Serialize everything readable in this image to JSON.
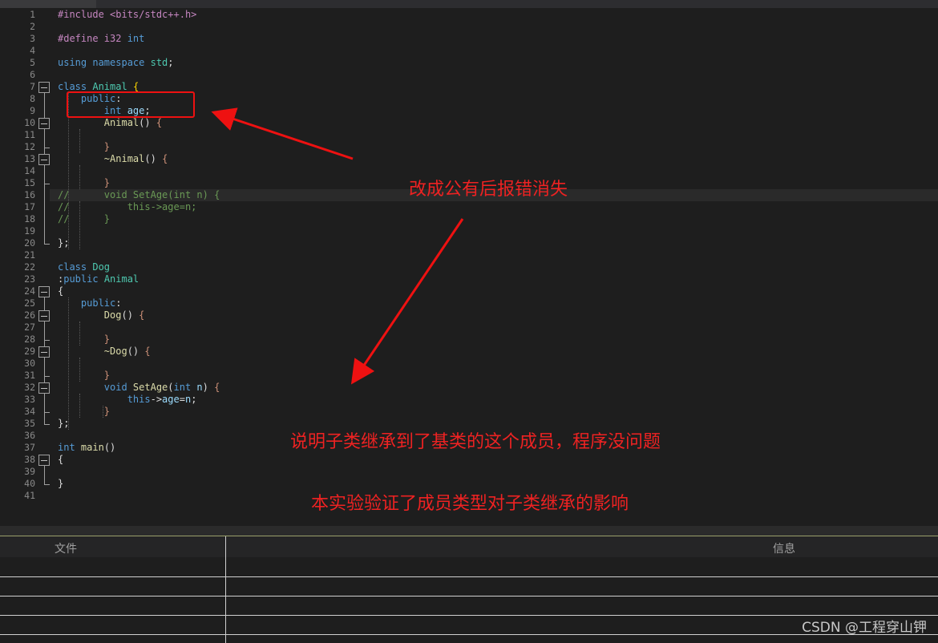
{
  "tab": {
    "label": ""
  },
  "code_lines": [
    {
      "n": "1",
      "tokens": [
        {
          "t": "#include <bits/stdc++.h>",
          "c": "pre"
        }
      ]
    },
    {
      "n": "2",
      "tokens": []
    },
    {
      "n": "3",
      "tokens": [
        {
          "t": "#define ",
          "c": "pre"
        },
        {
          "t": "i32 ",
          "c": "pre"
        },
        {
          "t": "int",
          "c": "kw"
        }
      ]
    },
    {
      "n": "4",
      "tokens": []
    },
    {
      "n": "5",
      "tokens": [
        {
          "t": "using ",
          "c": "kw"
        },
        {
          "t": "namespace ",
          "c": "kw"
        },
        {
          "t": "std",
          "c": "type"
        },
        {
          "t": ";",
          "c": ""
        }
      ]
    },
    {
      "n": "6",
      "tokens": []
    },
    {
      "n": "7",
      "tokens": [
        {
          "t": "class ",
          "c": "kw"
        },
        {
          "t": "Animal ",
          "c": "type"
        },
        {
          "t": "{",
          "c": "br"
        }
      ]
    },
    {
      "n": "8",
      "tokens": [
        {
          "t": "    public",
          "c": "kw"
        },
        {
          "t": ":",
          "c": ""
        }
      ]
    },
    {
      "n": "9",
      "tokens": [
        {
          "t": "        int ",
          "c": "kw"
        },
        {
          "t": "age",
          "c": "var"
        },
        {
          "t": ";",
          "c": ""
        }
      ]
    },
    {
      "n": "10",
      "tokens": [
        {
          "t": "        Animal",
          "c": "fn"
        },
        {
          "t": "() ",
          "c": ""
        },
        {
          "t": "{",
          "c": "str"
        }
      ]
    },
    {
      "n": "11",
      "tokens": []
    },
    {
      "n": "12",
      "tokens": [
        {
          "t": "        }",
          "c": "str"
        }
      ]
    },
    {
      "n": "13",
      "tokens": [
        {
          "t": "        ~Animal",
          "c": "fn"
        },
        {
          "t": "() ",
          "c": ""
        },
        {
          "t": "{",
          "c": "str"
        }
      ]
    },
    {
      "n": "14",
      "tokens": []
    },
    {
      "n": "15",
      "tokens": [
        {
          "t": "        }",
          "c": "str"
        }
      ]
    },
    {
      "n": "16",
      "tokens": [
        {
          "t": "//      void SetAge(int n) {",
          "c": "cm"
        }
      ]
    },
    {
      "n": "17",
      "tokens": [
        {
          "t": "//          this->age=n;",
          "c": "cm"
        }
      ]
    },
    {
      "n": "18",
      "tokens": [
        {
          "t": "//      }",
          "c": "cm"
        }
      ]
    },
    {
      "n": "19",
      "tokens": []
    },
    {
      "n": "20",
      "tokens": [
        {
          "t": "};",
          "c": ""
        }
      ]
    },
    {
      "n": "21",
      "tokens": []
    },
    {
      "n": "22",
      "tokens": [
        {
          "t": "class ",
          "c": "kw"
        },
        {
          "t": "Dog",
          "c": "type"
        }
      ]
    },
    {
      "n": "23",
      "tokens": [
        {
          "t": ":",
          "c": ""
        },
        {
          "t": "public ",
          "c": "kw"
        },
        {
          "t": "Animal",
          "c": "type"
        }
      ]
    },
    {
      "n": "24",
      "tokens": [
        {
          "t": "{",
          "c": ""
        }
      ]
    },
    {
      "n": "25",
      "tokens": [
        {
          "t": "    public",
          "c": "kw"
        },
        {
          "t": ":",
          "c": ""
        }
      ]
    },
    {
      "n": "26",
      "tokens": [
        {
          "t": "        Dog",
          "c": "fn"
        },
        {
          "t": "() ",
          "c": ""
        },
        {
          "t": "{",
          "c": "str"
        }
      ]
    },
    {
      "n": "27",
      "tokens": []
    },
    {
      "n": "28",
      "tokens": [
        {
          "t": "        }",
          "c": "str"
        }
      ]
    },
    {
      "n": "29",
      "tokens": [
        {
          "t": "        ~Dog",
          "c": "fn"
        },
        {
          "t": "() ",
          "c": ""
        },
        {
          "t": "{",
          "c": "str"
        }
      ]
    },
    {
      "n": "30",
      "tokens": []
    },
    {
      "n": "31",
      "tokens": [
        {
          "t": "        }",
          "c": "str"
        }
      ]
    },
    {
      "n": "32",
      "tokens": [
        {
          "t": "        void ",
          "c": "kw"
        },
        {
          "t": "SetAge",
          "c": "fn"
        },
        {
          "t": "(",
          "c": ""
        },
        {
          "t": "int ",
          "c": "kw"
        },
        {
          "t": "n",
          "c": "var"
        },
        {
          "t": ") ",
          "c": ""
        },
        {
          "t": "{",
          "c": "str"
        }
      ]
    },
    {
      "n": "33",
      "tokens": [
        {
          "t": "            this",
          "c": "kw"
        },
        {
          "t": "->",
          "c": ""
        },
        {
          "t": "age",
          "c": "var"
        },
        {
          "t": "=",
          "c": ""
        },
        {
          "t": "n",
          "c": "var"
        },
        {
          "t": ";",
          "c": ""
        }
      ]
    },
    {
      "n": "34",
      "tokens": [
        {
          "t": "        }",
          "c": "str"
        }
      ]
    },
    {
      "n": "35",
      "tokens": [
        {
          "t": "};",
          "c": ""
        }
      ]
    },
    {
      "n": "36",
      "tokens": []
    },
    {
      "n": "37",
      "tokens": [
        {
          "t": "int ",
          "c": "kw"
        },
        {
          "t": "main",
          "c": "fn"
        },
        {
          "t": "()",
          "c": ""
        }
      ]
    },
    {
      "n": "38",
      "tokens": [
        {
          "t": "{",
          "c": ""
        }
      ]
    },
    {
      "n": "39",
      "tokens": []
    },
    {
      "n": "40",
      "tokens": [
        {
          "t": "}",
          "c": ""
        }
      ]
    },
    {
      "n": "41",
      "tokens": []
    }
  ],
  "annotations": {
    "note1": "改成公有后报错消失",
    "note2": "说明子类继承到了基类的这个成员，程序没问题",
    "note3": "本实验验证了成员类型对子类继承的影响"
  },
  "panel": {
    "col_file": "文件",
    "col_info": "信息"
  },
  "watermark": "CSDN @工程穿山钾",
  "colors": {
    "annotation_red": "#ee2222",
    "background": "#1e1e1e"
  }
}
